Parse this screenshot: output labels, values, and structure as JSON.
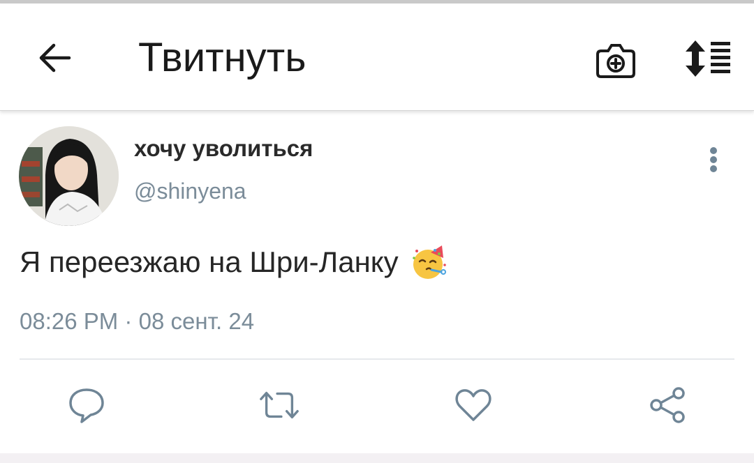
{
  "header": {
    "title": "Твитнуть",
    "back_icon": "arrow-left-icon",
    "camera_icon": "camera-plus-icon",
    "sort_icon": "sort-list-icon"
  },
  "tweet": {
    "display_name": "хочу уволиться",
    "handle": "@shinyena",
    "text": "Я переезжаю на Шри-Ланку",
    "emoji": "🥳",
    "time": "08:26 PM",
    "separator": "·",
    "date": "08 сент. 24"
  },
  "actions": [
    {
      "icon": "reply-icon"
    },
    {
      "icon": "retweet-icon"
    },
    {
      "icon": "like-icon"
    },
    {
      "icon": "share-icon"
    }
  ],
  "colors": {
    "text_primary": "#262626",
    "text_secondary": "#7b8c99",
    "icon_color": "#6f8596",
    "divider": "#e6e9ec"
  }
}
